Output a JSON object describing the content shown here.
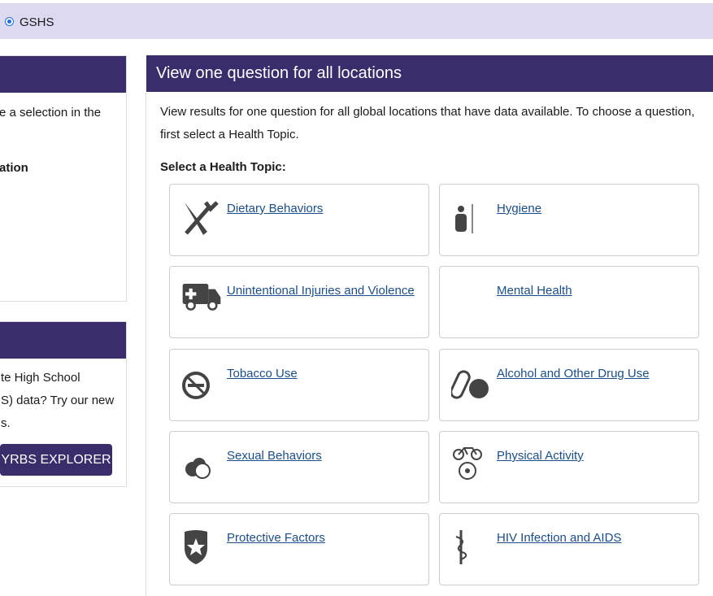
{
  "filter": {
    "radio_label": "GSHS",
    "selected": true
  },
  "left_panel": {
    "text_partial": "e a selection in the",
    "bold_partial": "ation"
  },
  "explorer_panel": {
    "lines": [
      "te High School",
      "S) data? Try our new",
      "s."
    ],
    "button": "YRBS EXPLORER"
  },
  "main": {
    "title": "View one question for all locations",
    "intro_line1": "View results for one question for all global locations that have data available. To choose a question,",
    "intro_line2": "first select a Health Topic.",
    "select_label": "Select a Health Topic:",
    "topics": [
      {
        "label": "Dietary Behaviors",
        "icon": "fork-knife-icon"
      },
      {
        "label": "Hygiene",
        "icon": "shower-icon"
      },
      {
        "label": "Unintentional Injuries and Violence",
        "icon": "ambulance-icon"
      },
      {
        "label": "Mental Health",
        "icon": "none"
      },
      {
        "label": "Tobacco Use",
        "icon": "no-smoking-icon"
      },
      {
        "label": "Alcohol and Other Drug Use",
        "icon": "pills-icon"
      },
      {
        "label": "Sexual Behaviors",
        "icon": "circles-icon"
      },
      {
        "label": "Physical Activity",
        "icon": "bike-ball-icon"
      },
      {
        "label": "Protective Factors",
        "icon": "shield-star-icon"
      },
      {
        "label": "HIV Infection and AIDS",
        "icon": "caduceus-icon"
      }
    ]
  },
  "colors": {
    "header": "#3b2c6c",
    "topbar": "#dcd9f1",
    "link": "#1a4e8a"
  }
}
